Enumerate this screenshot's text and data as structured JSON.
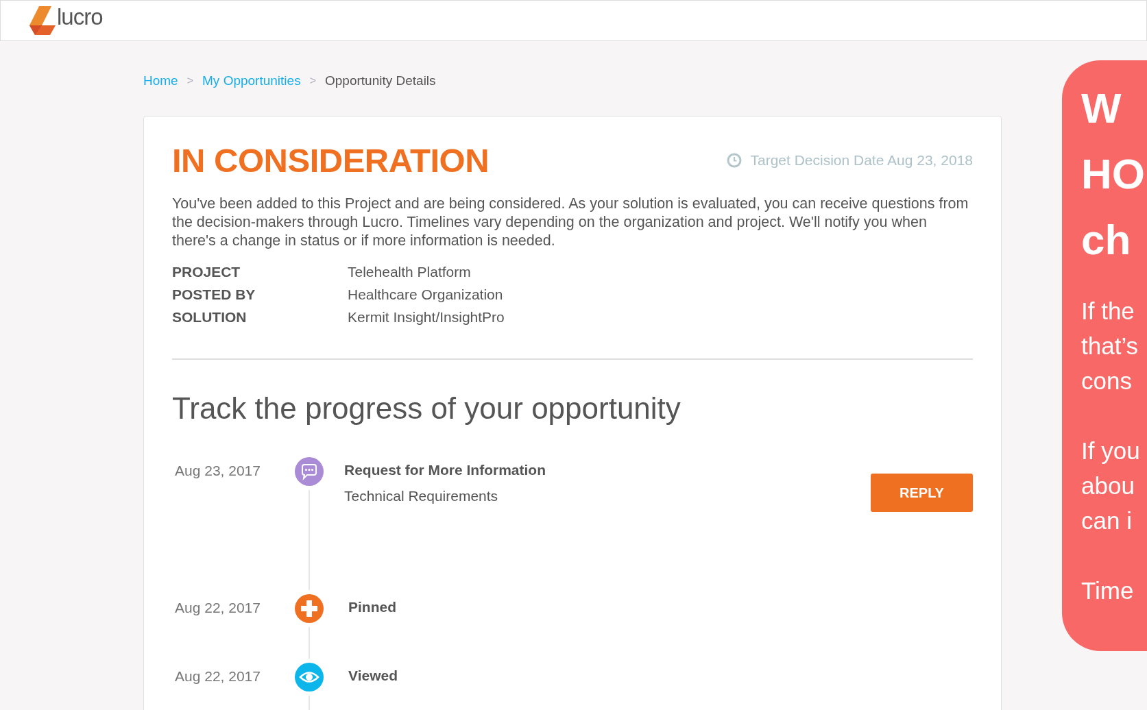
{
  "header": {
    "logo_text": "lucro"
  },
  "breadcrumb": [
    {
      "label": "Home",
      "kind": "link"
    },
    {
      "label": "My Opportunities",
      "kind": "link"
    },
    {
      "label": "Opportunity Details",
      "kind": "current"
    }
  ],
  "breadcrumb_separator": ">",
  "status": {
    "title": "IN CONSIDERATION",
    "target_date": "Target Decision Date Aug 23, 2018",
    "description": "You've been added to this Project and are being considered. As your solution is evaluated, you can receive questions from the decision-makers through Lucro. Timelines vary depending on the organization and project. We'll notify you when there's a change in status or if more information is needed."
  },
  "details": [
    {
      "label": "PROJECT",
      "value": "Telehealth Platform"
    },
    {
      "label": "POSTED BY",
      "value": "Healthcare Organization"
    },
    {
      "label": "SOLUTION",
      "value": "Kermit Insight/InsightPro"
    }
  ],
  "progress": {
    "heading": "Track the progress of your opportunity",
    "events": [
      {
        "date": "Aug 23, 2017",
        "kind": "request",
        "title": "Request for More Information",
        "subtitle": "Technical Requirements",
        "action": "REPLY"
      },
      {
        "date": "Aug 22, 2017",
        "kind": "pinned",
        "title": "Pinned"
      },
      {
        "date": "Aug 22, 2017",
        "kind": "viewed",
        "title": "Viewed"
      }
    ]
  },
  "side_panel": {
    "heading_lines": [
      "W",
      "HO",
      "ch"
    ],
    "paragraphs": [
      [
        "If the",
        "that’s",
        "cons"
      ],
      [
        "If you",
        "abou",
        "can i"
      ],
      [
        "Time"
      ]
    ]
  }
}
